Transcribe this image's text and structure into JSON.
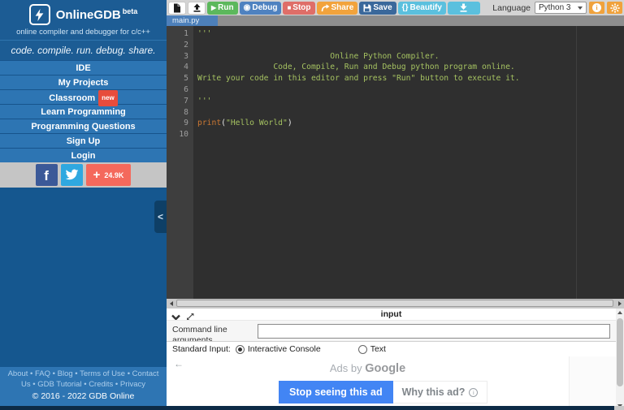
{
  "sidebar": {
    "logo": {
      "title": "OnlineGDB",
      "beta": "beta",
      "subtitle": "online compiler and debugger for c/c++"
    },
    "tagline": "code. compile. run. debug. share.",
    "menu": [
      {
        "label": "IDE"
      },
      {
        "label": "My Projects"
      },
      {
        "label": "Classroom",
        "badge": "new"
      },
      {
        "label": "Learn Programming"
      },
      {
        "label": "Programming Questions"
      },
      {
        "label": "Sign Up"
      },
      {
        "label": "Login"
      }
    ],
    "social": {
      "facebook_label": "f",
      "share_plus": "+",
      "share_count": "24.9K"
    },
    "collapse_label": "<",
    "footer": {
      "links": [
        "About",
        "FAQ",
        "Blog",
        "Terms of Use",
        "Contact Us",
        "GDB Tutorial",
        "Credits",
        "Privacy"
      ],
      "separator": "•",
      "copyright": "© 2016 - 2022 GDB Online"
    }
  },
  "toolbar": {
    "run_label": "Run",
    "debug_label": "Debug",
    "stop_label": "Stop",
    "share_label": "Share",
    "save_label": "Save",
    "beautify_icon": "{}",
    "beautify_label": "Beautify",
    "icons": {
      "run": "▶",
      "debug": "◉",
      "stop": "■"
    },
    "info_glyph": "i",
    "language_label": "Language",
    "language_value": "Python 3"
  },
  "editor": {
    "tab": "main.py",
    "lines": [
      {
        "n": "1",
        "tokens": [
          [
            "str",
            "'''"
          ]
        ]
      },
      {
        "n": "2",
        "tokens": []
      },
      {
        "n": "3",
        "tokens": [
          [
            "str",
            "                            Online Python Compiler."
          ]
        ]
      },
      {
        "n": "4",
        "tokens": [
          [
            "str",
            "                Code, Compile, Run and Debug python program online."
          ]
        ]
      },
      {
        "n": "5",
        "tokens": [
          [
            "str",
            "Write your code in this editor and press \"Run\" button to execute it."
          ]
        ]
      },
      {
        "n": "6",
        "tokens": []
      },
      {
        "n": "7",
        "tokens": [
          [
            "str",
            "'''"
          ]
        ]
      },
      {
        "n": "8",
        "tokens": []
      },
      {
        "n": "9",
        "tokens": [
          [
            "kw",
            "print"
          ],
          [
            "plain",
            "("
          ],
          [
            "str",
            "\"Hello World\""
          ],
          [
            "plain",
            ")"
          ]
        ]
      },
      {
        "n": "10",
        "tokens": []
      }
    ]
  },
  "io_panel": {
    "title": "input",
    "command_line_label": "Command line arguments",
    "command_line_value": "",
    "stdin_label": "Standard Input:",
    "radio_interactive": "Interactive Console",
    "radio_text": "Text",
    "stdin_selected": "Interactive Console"
  },
  "ad": {
    "back_arrow": "←",
    "header_prefix": "Ads by ",
    "header_brand": "Google",
    "stop_label": "Stop seeing this ad",
    "why_label": "Why this ad?",
    "info_glyph": "i"
  },
  "colors": {
    "sidebar_blue": "#2d75b3",
    "sidebar_dark": "#1c5c94",
    "sidebar_lower": "#15578f",
    "run_green": "#5cb85c",
    "debug_blue": "#4f82c0",
    "stop_red": "#df6e68",
    "share_orange": "#f2a33c",
    "save_blue": "#3a689b",
    "beautify_cyan": "#5bc0de",
    "settings_orange": "#f0a23c",
    "facebook_blue": "#3b5998",
    "twitter_blue": "#2fa8e0",
    "share_salmon": "#f4695c",
    "badge_red": "#e74c3c",
    "tab_blue": "#4d80ba",
    "editor_bg": "#2f2f2f",
    "gutter_bg": "#3e3e3e",
    "string_green": "#a5c261",
    "keyword_orange": "#cc7833",
    "ad_blue": "#4285f4"
  }
}
